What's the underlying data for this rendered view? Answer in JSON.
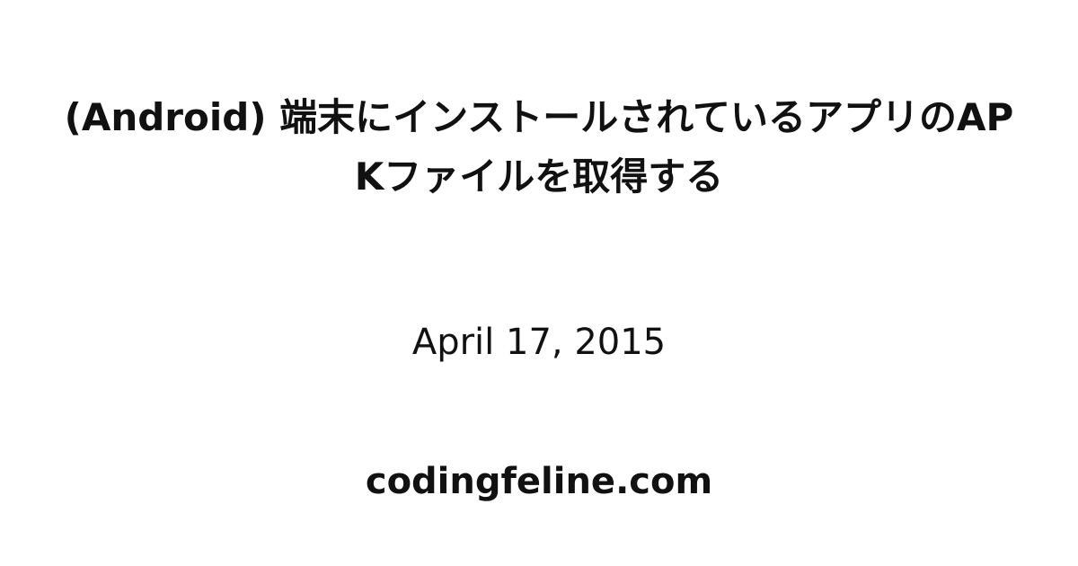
{
  "article": {
    "title": "(Android) 端末にインストールされているアプリのAPKファイルを取得する",
    "date": "April 17, 2015"
  },
  "site": {
    "domain": "codingfeline.com"
  }
}
